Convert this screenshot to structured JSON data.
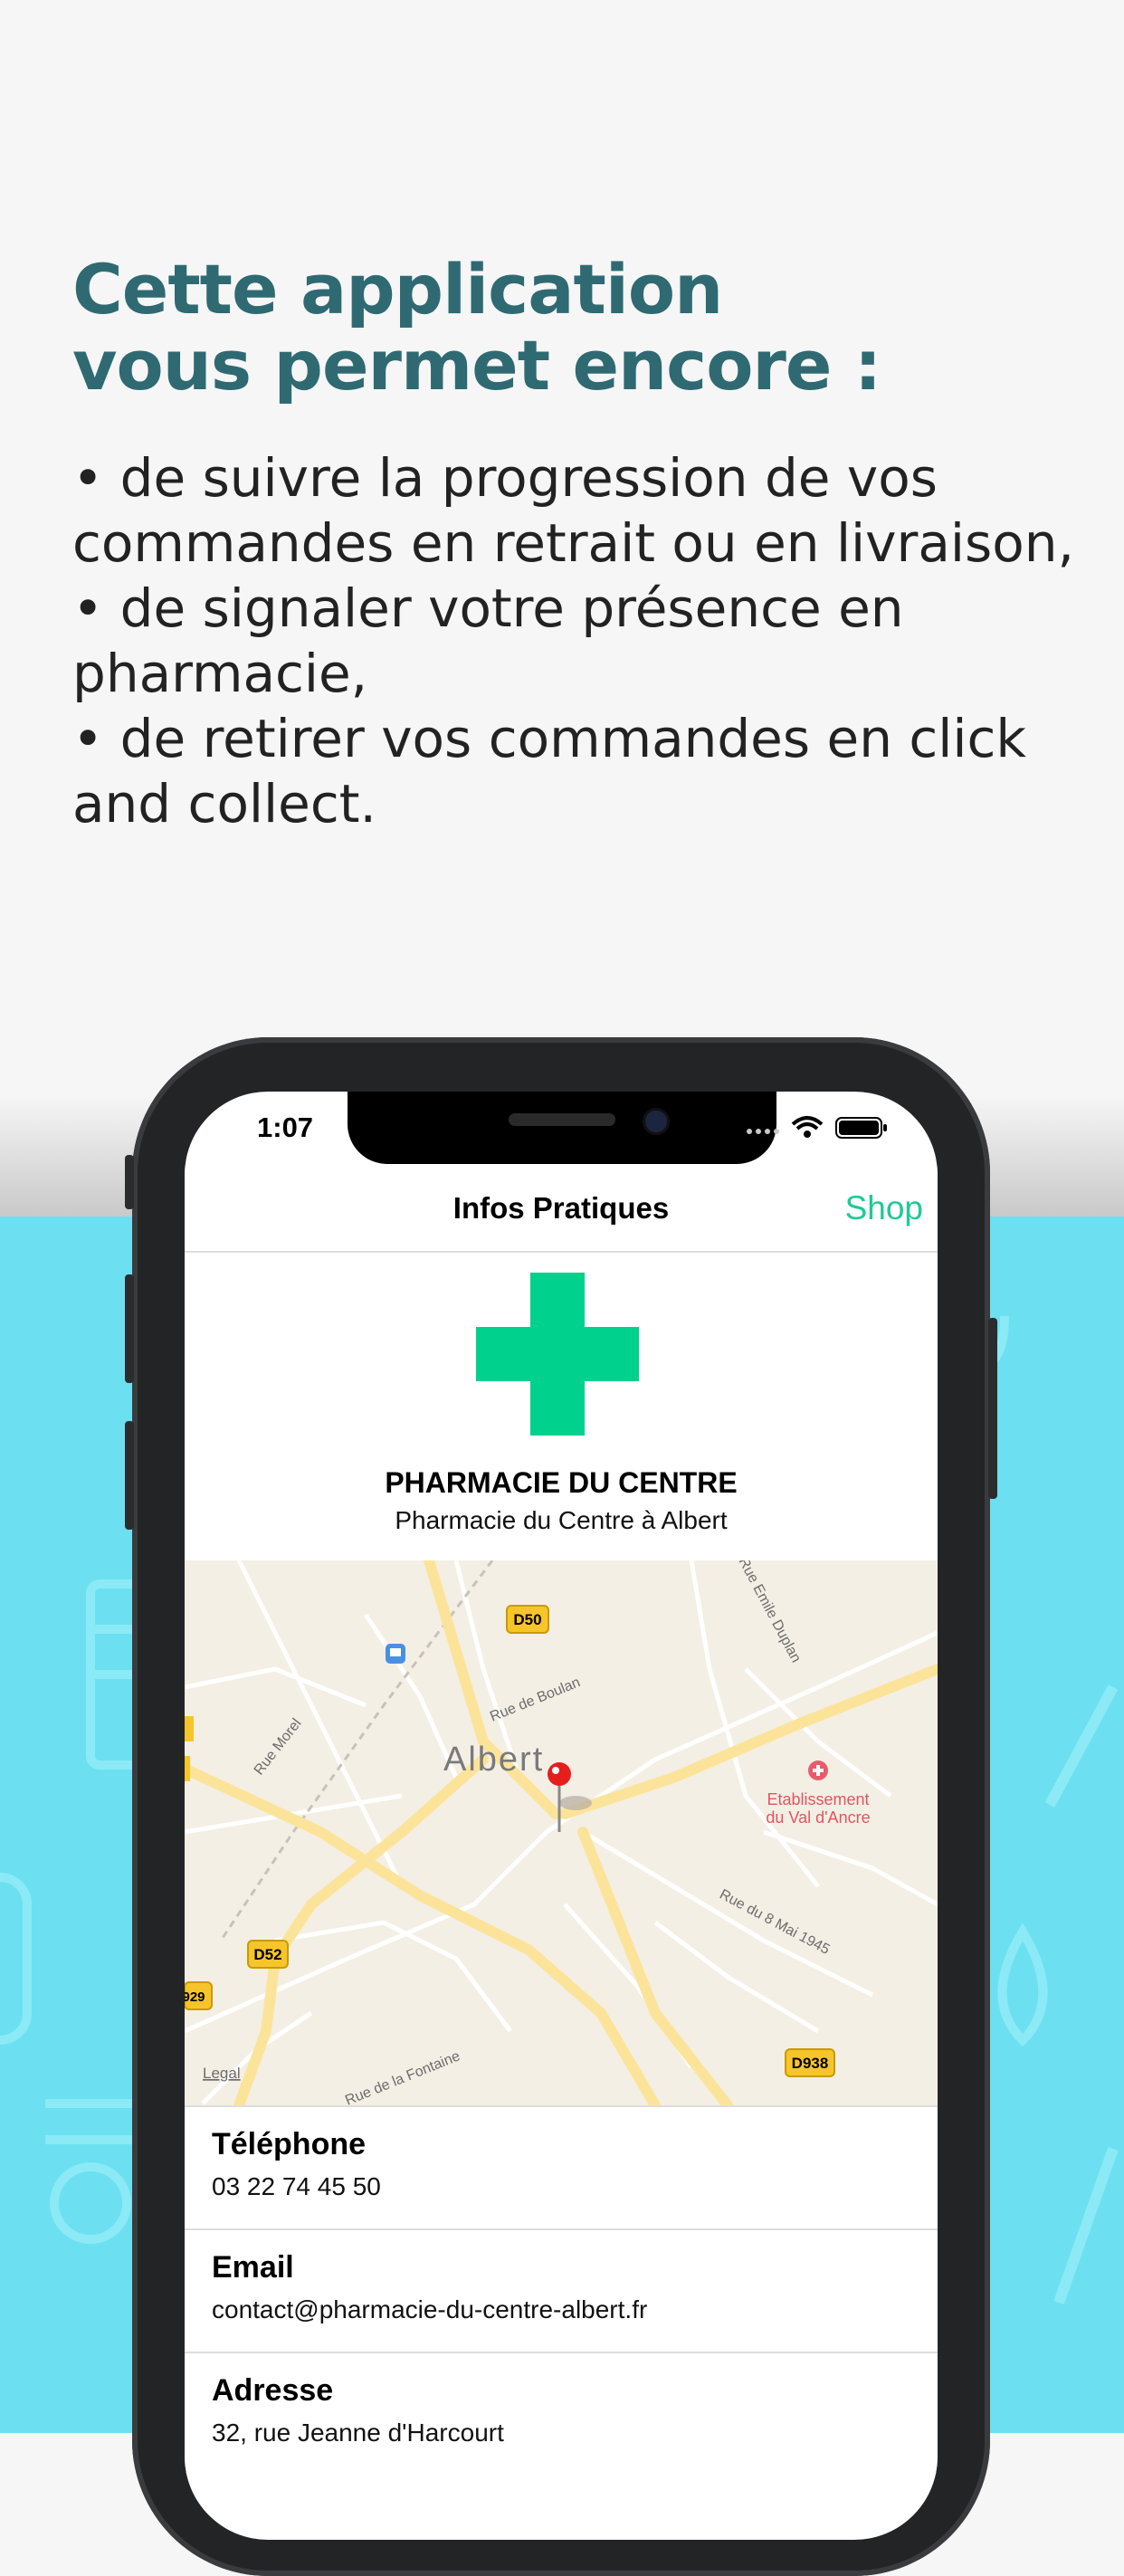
{
  "promo": {
    "headline_line1": "Cette application",
    "headline_line2": "vous permet encore :",
    "bullet1_line1": "• de suivre la progression de vos",
    "bullet1_line2": "commandes en retrait ou en livraison,",
    "bullet2_line1": "• de signaler votre présence en",
    "bullet2_line2": "pharmacie,",
    "bullet3_line1": "• de retirer vos commandes en click",
    "bullet3_line2": "and collect."
  },
  "status_bar": {
    "time": "1:07"
  },
  "navbar": {
    "title": "Infos Pratiques",
    "shop": "Shop"
  },
  "pharmacy": {
    "name": "PHARMACIE DU CENTRE",
    "subtitle": "Pharmacie du Centre à Albert"
  },
  "map": {
    "city": "Albert",
    "poi_line1": "Etablissement",
    "poi_line2": "du Val d'Ancre",
    "roads": {
      "d50": "D50",
      "d52": "D52",
      "d938": "D938",
      "d929": "929",
      "rue_boulan": "Rue de Boulan",
      "rue_morel": "Rue Morel",
      "rue_emile": "Rue Emile Duplan",
      "rue_8mai": "Rue du 8 Mai 1945",
      "rue_fontaine": "Rue de la Fontaine"
    },
    "legal": "Legal"
  },
  "info": {
    "phone_label": "Téléphone",
    "phone_value": "03 22 74 45 50",
    "email_label": "Email",
    "email_value": "contact@pharmacie-du-centre-albert.fr",
    "address_label": "Adresse",
    "address_value": "32, rue Jeanne d'Harcourt"
  },
  "colors": {
    "headline": "#2f6a73",
    "accent_green": "#21c997",
    "cross_green": "#00d18c",
    "background_cyan": "#6ce0f0"
  }
}
